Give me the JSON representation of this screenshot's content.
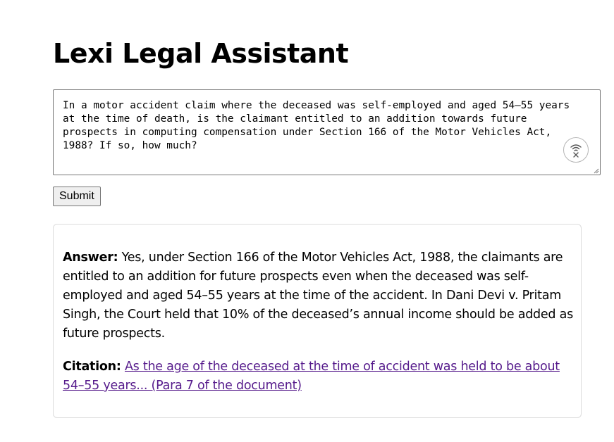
{
  "app": {
    "title": "Lexi Legal Assistant"
  },
  "query": {
    "value": "In a motor accident claim where the deceased was self-employed and aged 54–55 years at the time of death, is the claimant entitled to an addition towards future prospects in computing compensation under Section 166 of the Motor Vehicles Act, 1988? If so, how much?",
    "voice_icon": "voice-input-icon"
  },
  "actions": {
    "submit_label": "Submit"
  },
  "result": {
    "answer_label": "Answer:",
    "answer_text": "Yes, under Section 166 of the Motor Vehicles Act, 1988, the claimants are entitled to an addition for future prospects even when the deceased was self-employed and aged 54–55 years at the time of the accident. In Dani Devi v. Pritam Singh, the Court held that 10% of the deceased’s annual income should be added as future prospects.",
    "citation_label": "Citation:",
    "citation_link_text": "As the age of the deceased at the time of accident was held to be about 54–55 years... (Para 7 of the document)",
    "link_color": "#551a8b"
  }
}
